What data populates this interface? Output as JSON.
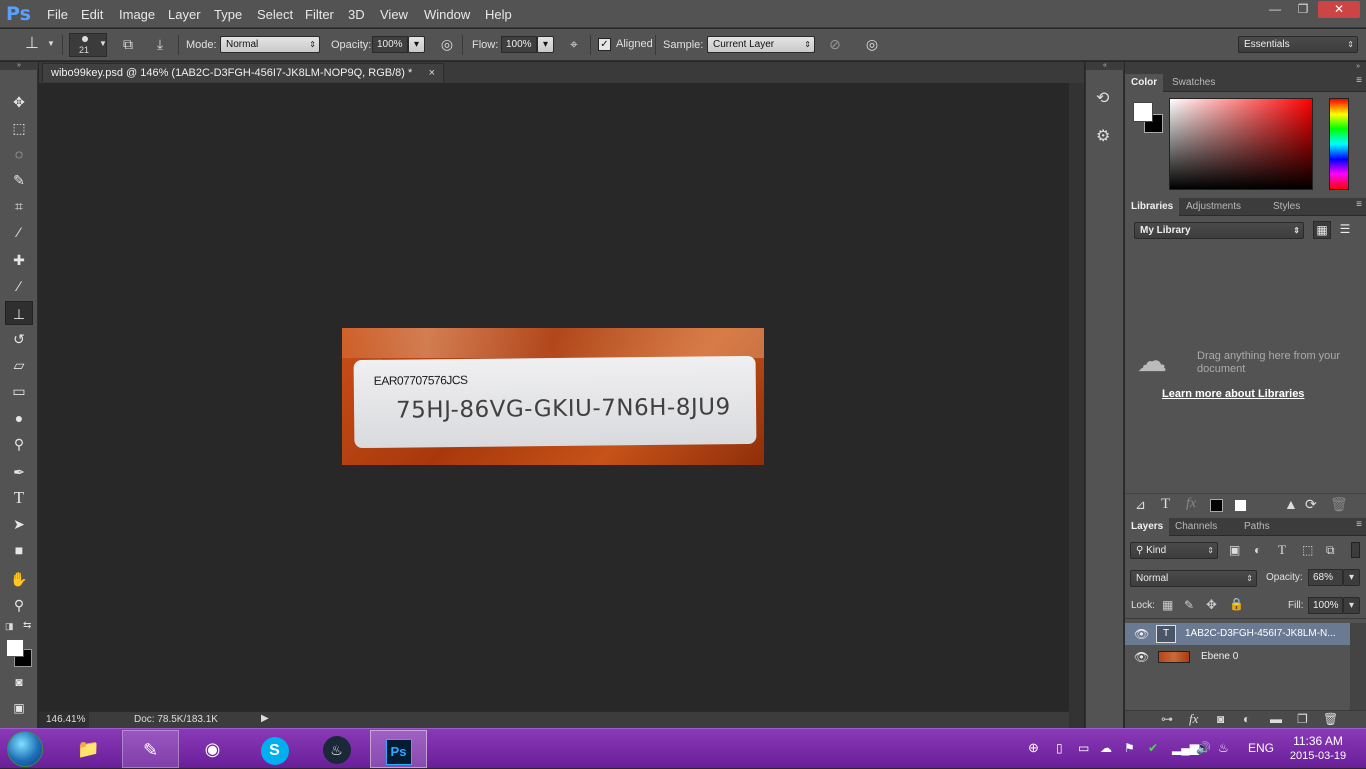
{
  "app": {
    "logo": "Ps"
  },
  "menu": [
    "File",
    "Edit",
    "Image",
    "Layer",
    "Type",
    "Select",
    "Filter",
    "3D",
    "View",
    "Window",
    "Help"
  ],
  "window_controls": {
    "minimize": "—",
    "restore": "❐",
    "close": "✕"
  },
  "options": {
    "brush_size": "21",
    "mode_label": "Mode:",
    "mode_value": "Normal",
    "opacity_label": "Opacity:",
    "opacity_value": "100%",
    "flow_label": "Flow:",
    "flow_value": "100%",
    "aligned_label": "Aligned",
    "sample_label": "Sample:",
    "sample_value": "Current Layer",
    "workspace": "Essentials"
  },
  "document": {
    "tab_title": "wibo99key.psd @ 146% (1AB2C-D3FGH-456I7-JK8LM-NOP9Q, RGB/8) *",
    "tab_close": "×",
    "zoom": "146.41%",
    "doc_size": "Doc: 78.5K/183.1K",
    "image": {
      "serial": "EAR07707576JCS",
      "product_key": "75HJ-86VG-GKIU-7N6H-8JU9"
    }
  },
  "color_panel": {
    "tabs": [
      "Color",
      "Swatches"
    ]
  },
  "libraries_panel": {
    "tabs": [
      "Libraries",
      "Adjustments",
      "Styles"
    ],
    "library_name": "My Library",
    "drag_hint": "Drag anything here from your document",
    "learn_more": "Learn more about Libraries"
  },
  "layers_panel": {
    "tabs": [
      "Layers",
      "Channels",
      "Paths"
    ],
    "filter_kind": "Kind",
    "blend_mode": "Normal",
    "opacity_label": "Opacity:",
    "opacity_value": "68%",
    "lock_label": "Lock:",
    "fill_label": "Fill:",
    "fill_value": "100%",
    "layers": [
      {
        "name": "1AB2C-D3FGH-456I7-JK8LM-N...",
        "selected": true
      },
      {
        "name": "Ebene 0",
        "selected": false
      }
    ]
  },
  "taskbar": {
    "language": "ENG",
    "time": "11:36 AM",
    "date": "2015-03-19"
  },
  "colors": {
    "ui_panel": "#535353",
    "canvas": "#282828",
    "selected_layer": "#6b7a93",
    "taskbar": "#7a2aa8",
    "ps_blue": "#5aa0ff"
  }
}
